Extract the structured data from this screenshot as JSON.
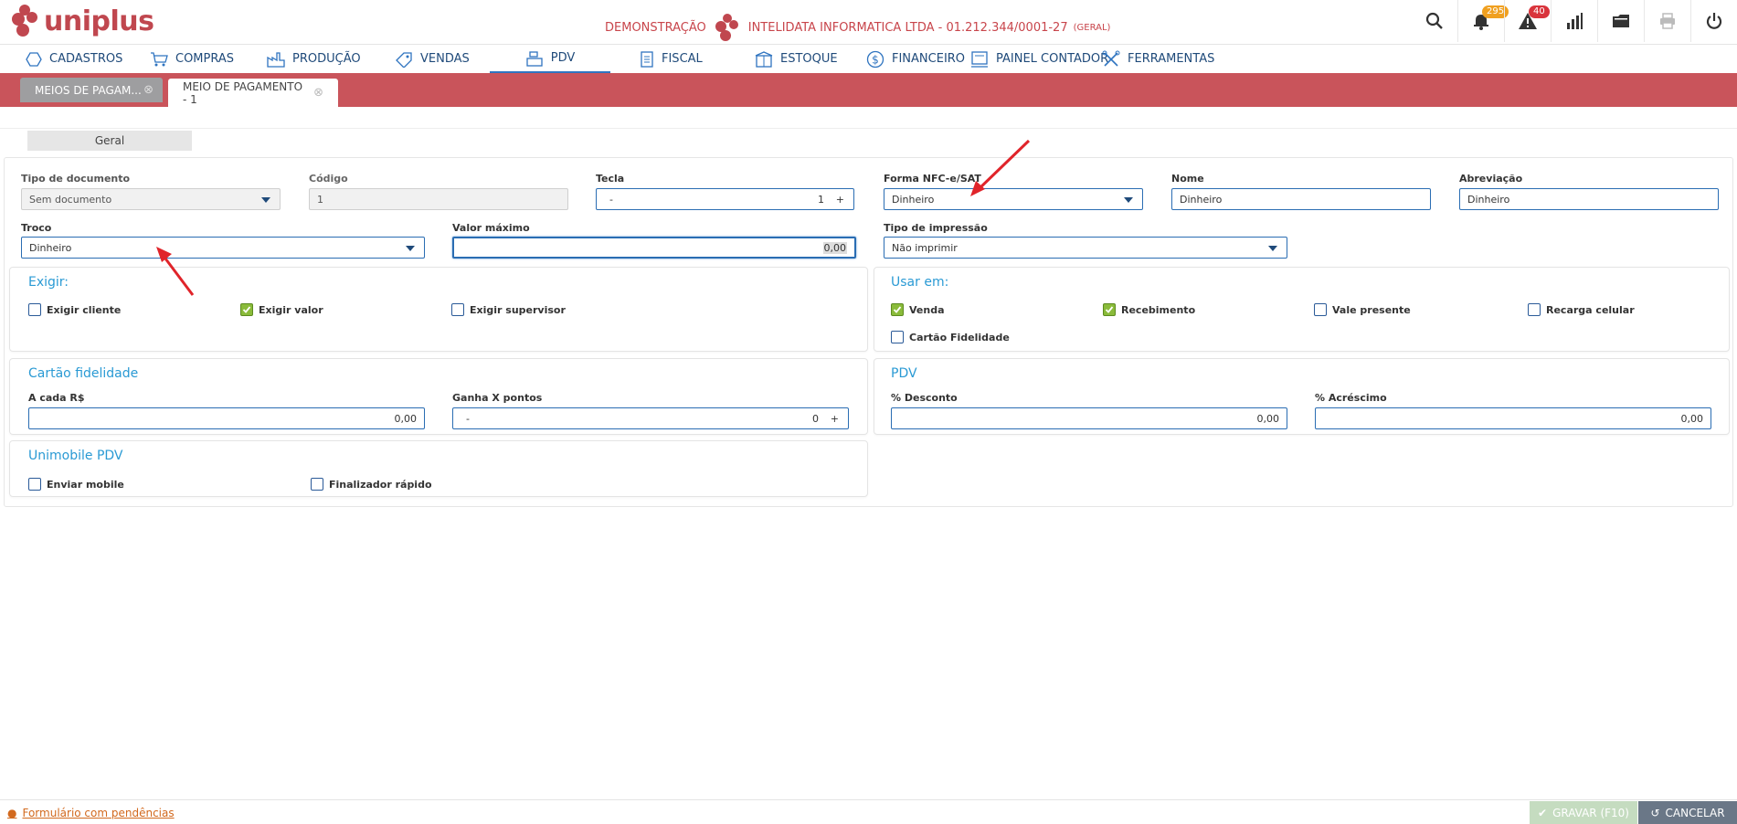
{
  "header": {
    "logo_text": "uniplus",
    "env_label": "DEMONSTRAÇÃO",
    "company": "INTELIDATA INFORMATICA LTDA - 01.212.344/0001-27",
    "scope": "(GERAL)",
    "notifications_count": "295",
    "alerts_count": "40",
    "accent": "#c9545b"
  },
  "nav": {
    "items": [
      {
        "label": "CADASTROS",
        "icon": "hexagon-icon"
      },
      {
        "label": "COMPRAS",
        "icon": "cart-icon"
      },
      {
        "label": "PRODUÇÃO",
        "icon": "factory-icon"
      },
      {
        "label": "VENDAS",
        "icon": "tag-icon"
      },
      {
        "label": "PDV",
        "icon": "register-icon"
      },
      {
        "label": "FISCAL",
        "icon": "document-icon"
      },
      {
        "label": "ESTOQUE",
        "icon": "box-icon"
      },
      {
        "label": "FINANCEIRO",
        "icon": "dollar-icon"
      },
      {
        "label": "PAINEL CONTADOR",
        "icon": "ledger-icon"
      },
      {
        "label": "FERRAMENTAS",
        "icon": "tools-icon"
      }
    ],
    "active": "PDV"
  },
  "tabs": [
    {
      "label": "MEIOS DE PAGAM...",
      "active": false
    },
    {
      "label": "MEIO DE PAGAMENTO - 1",
      "active": true
    }
  ],
  "form": {
    "section_tab": "Geral",
    "tipo_documento": {
      "label": "Tipo de documento",
      "value": "Sem documento"
    },
    "codigo": {
      "label": "Código",
      "value": "1"
    },
    "tecla": {
      "label": "Tecla",
      "minus": "-",
      "value": "1",
      "plus": "+"
    },
    "forma_nfce": {
      "label": "Forma NFC-e/SAT",
      "value": "Dinheiro"
    },
    "nome": {
      "label": "Nome",
      "value": "Dinheiro"
    },
    "abreviacao": {
      "label": "Abreviação",
      "value": "Dinheiro"
    },
    "troco": {
      "label": "Troco",
      "value": "Dinheiro"
    },
    "valor_maximo": {
      "label": "Valor máximo",
      "value": "0,00"
    },
    "tipo_impressao": {
      "label": "Tipo de impressão",
      "value": "Não imprimir"
    }
  },
  "exigir": {
    "title": "Exigir:",
    "items": [
      {
        "label": "Exigir cliente",
        "checked": false
      },
      {
        "label": "Exigir valor",
        "checked": true
      },
      {
        "label": "Exigir supervisor",
        "checked": false
      }
    ]
  },
  "usar_em": {
    "title": "Usar em:",
    "items": [
      {
        "label": "Venda",
        "checked": true
      },
      {
        "label": "Recebimento",
        "checked": true
      },
      {
        "label": "Vale presente",
        "checked": false
      },
      {
        "label": "Recarga celular",
        "checked": false
      },
      {
        "label": "Cartão Fidelidade",
        "checked": false
      }
    ]
  },
  "cartao_fidelidade": {
    "title": "Cartão fidelidade",
    "a_cada": {
      "label": "A cada R$",
      "value": "0,00"
    },
    "ganha": {
      "label": "Ganha X pontos",
      "minus": "-",
      "value": "0",
      "plus": "+"
    }
  },
  "pdv": {
    "title": "PDV",
    "desconto": {
      "label": "% Desconto",
      "value": "0,00"
    },
    "acrescimo": {
      "label": "% Acréscimo",
      "value": "0,00"
    }
  },
  "unimobile": {
    "title": "Unimobile PDV",
    "items": [
      {
        "label": "Enviar mobile",
        "checked": false
      },
      {
        "label": "Finalizador rápido",
        "checked": false
      }
    ]
  },
  "footer": {
    "pending": "Formulário com pendências",
    "save": "GRAVAR (F10)",
    "cancel": "CANCELAR"
  }
}
